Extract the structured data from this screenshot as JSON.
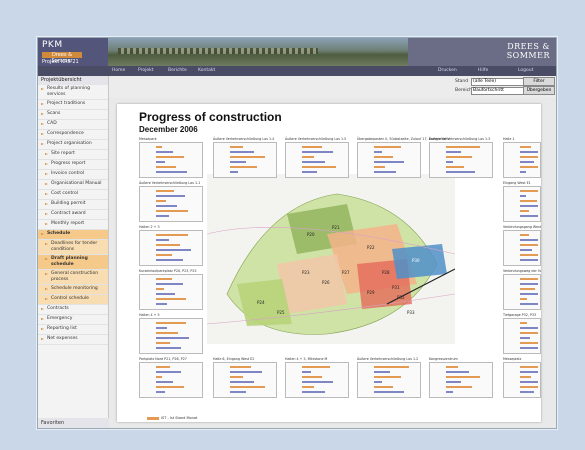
{
  "app": {
    "logo_brand": "PKM",
    "logo_sub": "Drees & Sommer",
    "logo_project": "Projekt KRS 21",
    "company_line1": "DREES &",
    "company_line2": "SOMMER"
  },
  "nav": {
    "items": [
      "Home",
      "Projekt",
      "Berichte",
      "Kontakt"
    ],
    "right_items": [
      "Drucken",
      "Hilfe",
      "Logout"
    ]
  },
  "sidebar": {
    "header": "Projektübersicht",
    "items": [
      {
        "label": "Results of planning services",
        "level": 0,
        "state": ""
      },
      {
        "label": "Project traditions",
        "level": 0,
        "state": ""
      },
      {
        "label": "Scans",
        "level": 0,
        "state": ""
      },
      {
        "label": "CAD",
        "level": 0,
        "state": ""
      },
      {
        "label": "Correspondence",
        "level": 0,
        "state": ""
      },
      {
        "label": "Project organisation",
        "level": 0,
        "state": ""
      },
      {
        "label": "Site report",
        "level": 1,
        "state": ""
      },
      {
        "label": "Progress report",
        "level": 1,
        "state": ""
      },
      {
        "label": "Invoice control",
        "level": 1,
        "state": ""
      },
      {
        "label": "Organisational Manual",
        "level": 1,
        "state": ""
      },
      {
        "label": "Cost control",
        "level": 1,
        "state": ""
      },
      {
        "label": "Building permit",
        "level": 1,
        "state": ""
      },
      {
        "label": "Contract award",
        "level": 1,
        "state": ""
      },
      {
        "label": "Monthly report",
        "level": 1,
        "state": ""
      },
      {
        "label": "Schedule",
        "level": 0,
        "state": "hl bold"
      },
      {
        "label": "Deadlines for tender conditions",
        "level": 1,
        "state": "hl2"
      },
      {
        "label": "Draft planning schedule",
        "level": 1,
        "state": "hl bold"
      },
      {
        "label": "General construction process",
        "level": 1,
        "state": "hl2"
      },
      {
        "label": "Schedule monitoring",
        "level": 1,
        "state": "hl2"
      },
      {
        "label": "Control schedule",
        "level": 1,
        "state": "hl2"
      },
      {
        "label": "Contracts",
        "level": 0,
        "state": ""
      },
      {
        "label": "Emergency",
        "level": 0,
        "state": ""
      },
      {
        "label": "Reporting list",
        "level": 0,
        "state": ""
      },
      {
        "label": "Net expenses",
        "level": 0,
        "state": ""
      }
    ],
    "footer": "Favoriten"
  },
  "filters": {
    "label1": "Stand",
    "value1": "(alle Teile)",
    "label2": "Bereich",
    "value2": "Baufortschritt",
    "button1": "Filter",
    "button2": "Übergeben"
  },
  "document": {
    "title": "Progress of construction",
    "subtitle": "December 2006",
    "legend": "IST - Ist Stand Monat",
    "zone_labels": [
      "P20",
      "P21",
      "P22",
      "P23",
      "P24",
      "P25",
      "P26",
      "P27",
      "P28",
      "P29",
      "P30",
      "P31",
      "P32",
      "P33"
    ],
    "minis": [
      "Messepark",
      "Äußere Verkehrserschließung Los 1.4",
      "Äußere Verkehrserschließung Los 1.5",
      "Übergabeposten II, Südostseite, Zulauf 17, Energiehof V",
      "Äußere Verkehrserschließung Los 1.3",
      "Halle 1",
      "Äußere Verkehrserschließung Los 1.1",
      "Eingang West E1",
      "Hallen 2 + 3",
      "Verbindungsgang West",
      "Kurzeinlaufparkplatz P20, P23, P25",
      "Verbindungsweg der Halle 4 (P28, P31)",
      "Hallen 4 + 5",
      "Tiefgarage P32, P33",
      "Parkplatz Nord P21, P26, P27",
      "Halle 6, Eingang West E2",
      "Hallen 4 + 5, Milestone M",
      "Äußere Verkehrserschließung Los 1.2",
      "Kongresszentrum",
      "Messeplatz"
    ]
  },
  "colors": {
    "accent": "#d18a3a",
    "bar_ist": "#e39a52",
    "bar_soll": "#7f86c4"
  }
}
